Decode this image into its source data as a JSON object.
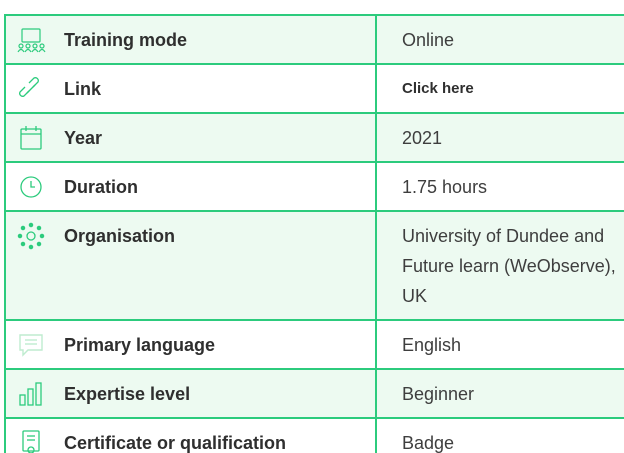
{
  "rows": [
    {
      "icon": "classroom-icon",
      "label": "Training mode",
      "value": "Online"
    },
    {
      "icon": "link-icon",
      "label": "Link",
      "value": "Click here"
    },
    {
      "icon": "calendar-icon",
      "label": "Year",
      "value": "2021"
    },
    {
      "icon": "clock-icon",
      "label": "Duration",
      "value": "1.75 hours"
    },
    {
      "icon": "network-icon",
      "label": "Organisation",
      "value": "University of Dundee and Future learn (WeObserve), UK"
    },
    {
      "icon": "speech-bubble-icon",
      "label": "Primary language",
      "value": "English"
    },
    {
      "icon": "bar-chart-icon",
      "label": "Expertise level",
      "value": "Beginner"
    },
    {
      "icon": "certificate-icon",
      "label": "Certificate or qualification",
      "value": "Badge"
    }
  ],
  "colors": {
    "border": "#2ccb7d",
    "alt_row_bg": "#edfaf1",
    "icon": "#2ccb7d"
  }
}
